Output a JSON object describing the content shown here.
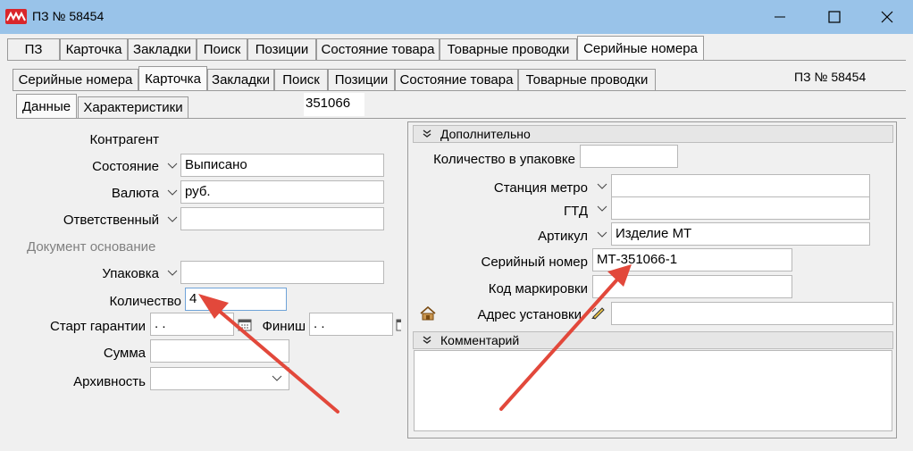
{
  "window": {
    "title": "ПЗ № 58454"
  },
  "top_tabs": [
    "ПЗ",
    "Карточка",
    "Закладки",
    "Поиск",
    "Позиции",
    "Состояние товара",
    "Товарные проводки",
    "Серийные номера"
  ],
  "inner_tabs": [
    "Серийные номера",
    "Карточка",
    "Закладки",
    "Поиск",
    "Позиции",
    "Состояние товара",
    "Товарные проводки"
  ],
  "doc_label": "ПЗ № 58454",
  "sub_tabs": [
    "Данные",
    "Характеристики"
  ],
  "serial_id": "351066",
  "left_form": {
    "kontragent": "Контрагент",
    "sostoyanie_label": "Состояние",
    "sostoyanie_value": "Выписано",
    "valyuta_label": "Валюта",
    "valyuta_value": "руб.",
    "otvetstvenny_label": "Ответственный",
    "otvetstvenny_value": "",
    "doc_osnovanie": "Документ основание",
    "upakovka_label": "Упаковка",
    "upakovka_value": "",
    "kolichestvo_label": "Количество",
    "kolichestvo_value": "4",
    "start_label": "Старт гарантии",
    "start_value": " .  .",
    "finish_label": "Финиш",
    "finish_value": " .  .",
    "summa_label": "Сумма",
    "summa_value": "",
    "arkhivnost_label": "Архивность",
    "arkhivnost_value": ""
  },
  "right_form": {
    "section1_title": "Дополнительно",
    "kol_upak_label": "Количество в упаковке",
    "kol_upak_value": "",
    "metro_label": "Станция метро",
    "metro_value": "",
    "gtd_label": "ГТД",
    "gtd_value": "",
    "artikul_label": "Артикул",
    "artikul_value": "Изделие МТ",
    "serial_label": "Серийный номер",
    "serial_value": "МТ-351066-1",
    "kod_label": "Код маркировки",
    "kod_value": "",
    "adres_label": "Адрес установки",
    "adres_value": "",
    "section2_title": "Комментарий",
    "comment_value": ""
  },
  "colors": {
    "titlebar": "#99c3e9",
    "arrow": "#e2483b",
    "app_icon": "#d9262b"
  }
}
